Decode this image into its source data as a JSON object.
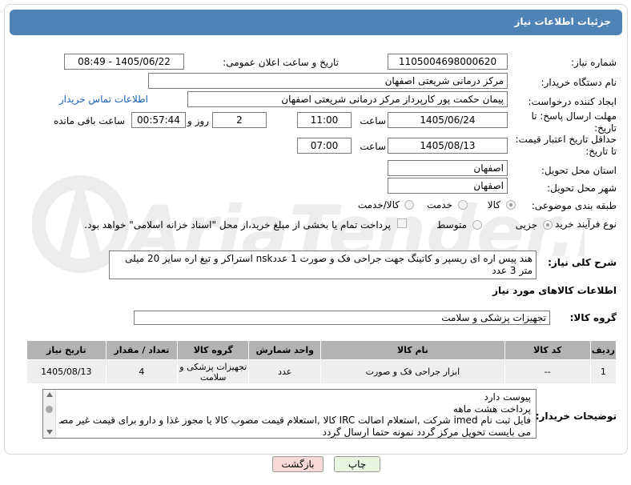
{
  "title": "جزئیات اطلاعات نیاز",
  "fields": {
    "need_number_label": "شماره نیاز:",
    "need_number": "1105004698000620",
    "announce_label": "تاریخ و ساعت اعلان عمومی:",
    "announce_value": "1405/06/22 - 08:49",
    "buyer_org_label": "نام دستگاه خریدار:",
    "buyer_org": "مرکز درمانی شریعتی اصفهان",
    "creator_label": "ایجاد کننده درخواست:",
    "creator": "پیمان حکمت پور کارپرداز مرکز درمانی شریعتی اصفهان",
    "contact_link": "اطلاعات تماس خریدار",
    "deadline_label": "مهلت ارسال پاسخ: تا تاریخ:",
    "deadline_date": "1405/06/24",
    "time_label": "ساعت",
    "deadline_time": "11:00",
    "days_value": "2",
    "days_label": "روز و",
    "remaining_time": "00:57:44",
    "remaining_label": "ساعت باقی مانده",
    "price_validity_label": "حداقل تاریخ اعتبار قیمت: تا تاریخ:",
    "price_date": "1405/08/13",
    "price_time": "07:00",
    "province_label": "استان محل تحویل:",
    "province": "اصفهان",
    "city_label": "شهر محل تحویل:",
    "city": "اصفهان",
    "category_label": "طبقه بندی موضوعی:",
    "category_options": [
      "کالا",
      "خدمت",
      "کالا/خدمت"
    ],
    "process_label": "نوع فرآیند خرید :",
    "process_options": [
      "جزیی",
      "متوسط"
    ],
    "payment_note": "پرداخت تمام یا بخشی از مبلغ خرید،از محل \"اسناد خزانه اسلامی\" خواهد بود.",
    "description_label": "شرح کلی نیاز:",
    "description": "هند پیس اره ای ریسپر و کاتینگ جهت جراحی فک و صورت 1 عددnsk استراکر و تیغ اره سایز 20 میلی متر 3 عدد",
    "goods_info_title": "اطلاعات کالاهای مورد نیاز",
    "goods_group_label": "گروه کالا:",
    "goods_group": "تجهیزات پزشکی و سلامت"
  },
  "table": {
    "headers": [
      "ردیف",
      "کد کالا",
      "نام کالا",
      "واحد شمارش",
      "گروه کالا",
      "تعداد / مقدار",
      "تاریخ نیاز"
    ],
    "rows": [
      [
        "1",
        "--",
        "ابزار جراحی فک و صورت",
        "عدد",
        "تجهیزات پزشکی و سلامت",
        "4",
        "1405/08/13"
      ]
    ]
  },
  "buyer_notes_label": "توضیحات خریدار:",
  "buyer_notes": [
    "پیوست دارد",
    "پرداخت هشت ماهه",
    "فایل ثبت نام imed شرکت ,استعلام اصالت IRC کالا ,استعلام قیمت مصوب کالا یا مجوز غذا و دارو برای قیمت غیر مصوب",
    "می بایست تحویل مرکز گردد نمونه حتما ارسال گردد"
  ],
  "buttons": {
    "print": "چاپ",
    "back": "بازگشت"
  },
  "watermark_text": "AriaTender.neT",
  "colors": {
    "title_bar": "#4f82b7",
    "table_header": "#b3b3b3",
    "table_row": "#eeeeee",
    "back_button": "#f9d9d9",
    "print_button": "#e9f5e1"
  }
}
